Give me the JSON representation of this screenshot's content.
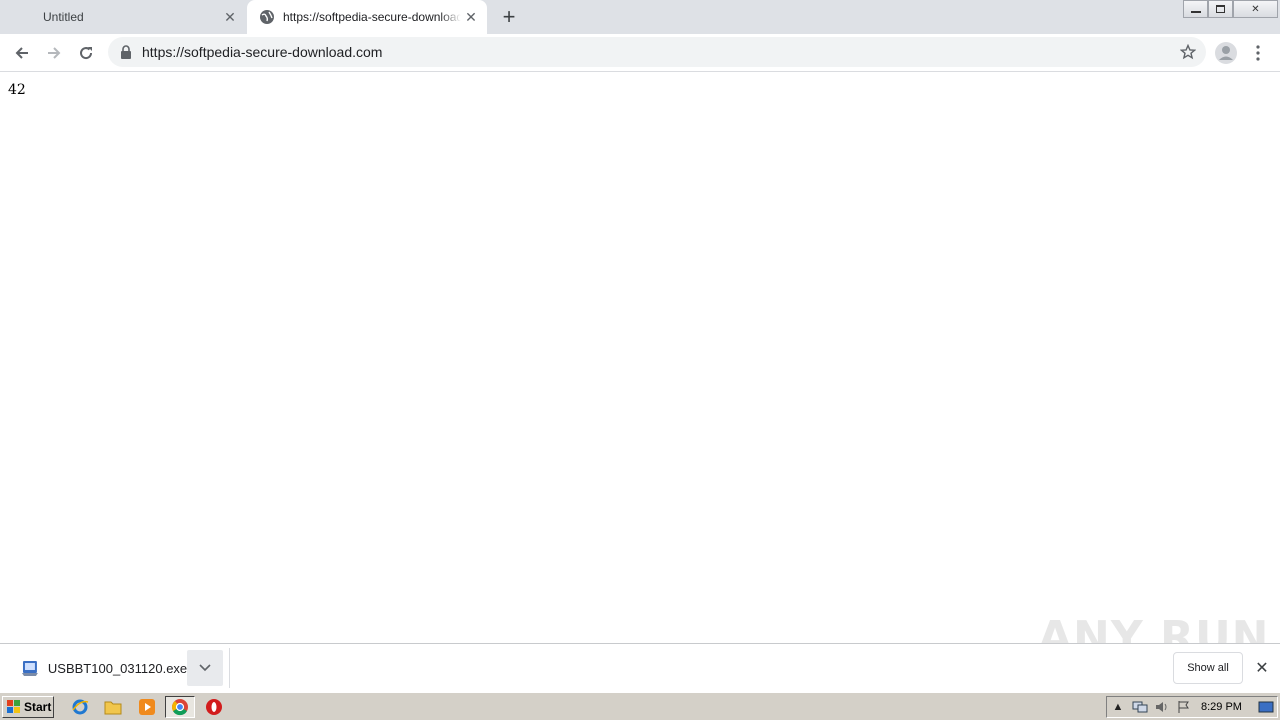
{
  "tabs": [
    {
      "title": "Untitled",
      "active": false
    },
    {
      "title": "https://softpedia-secure-download.com",
      "active": true
    }
  ],
  "window_controls": {
    "minimize": "—",
    "restore": "❐",
    "close": "✕"
  },
  "toolbar": {
    "url": "https://softpedia-secure-download.com"
  },
  "page": {
    "body_text": "42"
  },
  "download_shelf": {
    "filename": "USBBT100_031120.exe",
    "show_all_label": "Show all"
  },
  "watermark": "ANY RUN",
  "taskbar": {
    "start_label": "Start",
    "clock": "8:29 PM"
  },
  "colors": {
    "tabstrip": "#dee1e6",
    "omnibox": "#f1f3f4",
    "taskbar": "#d4d0c8"
  }
}
